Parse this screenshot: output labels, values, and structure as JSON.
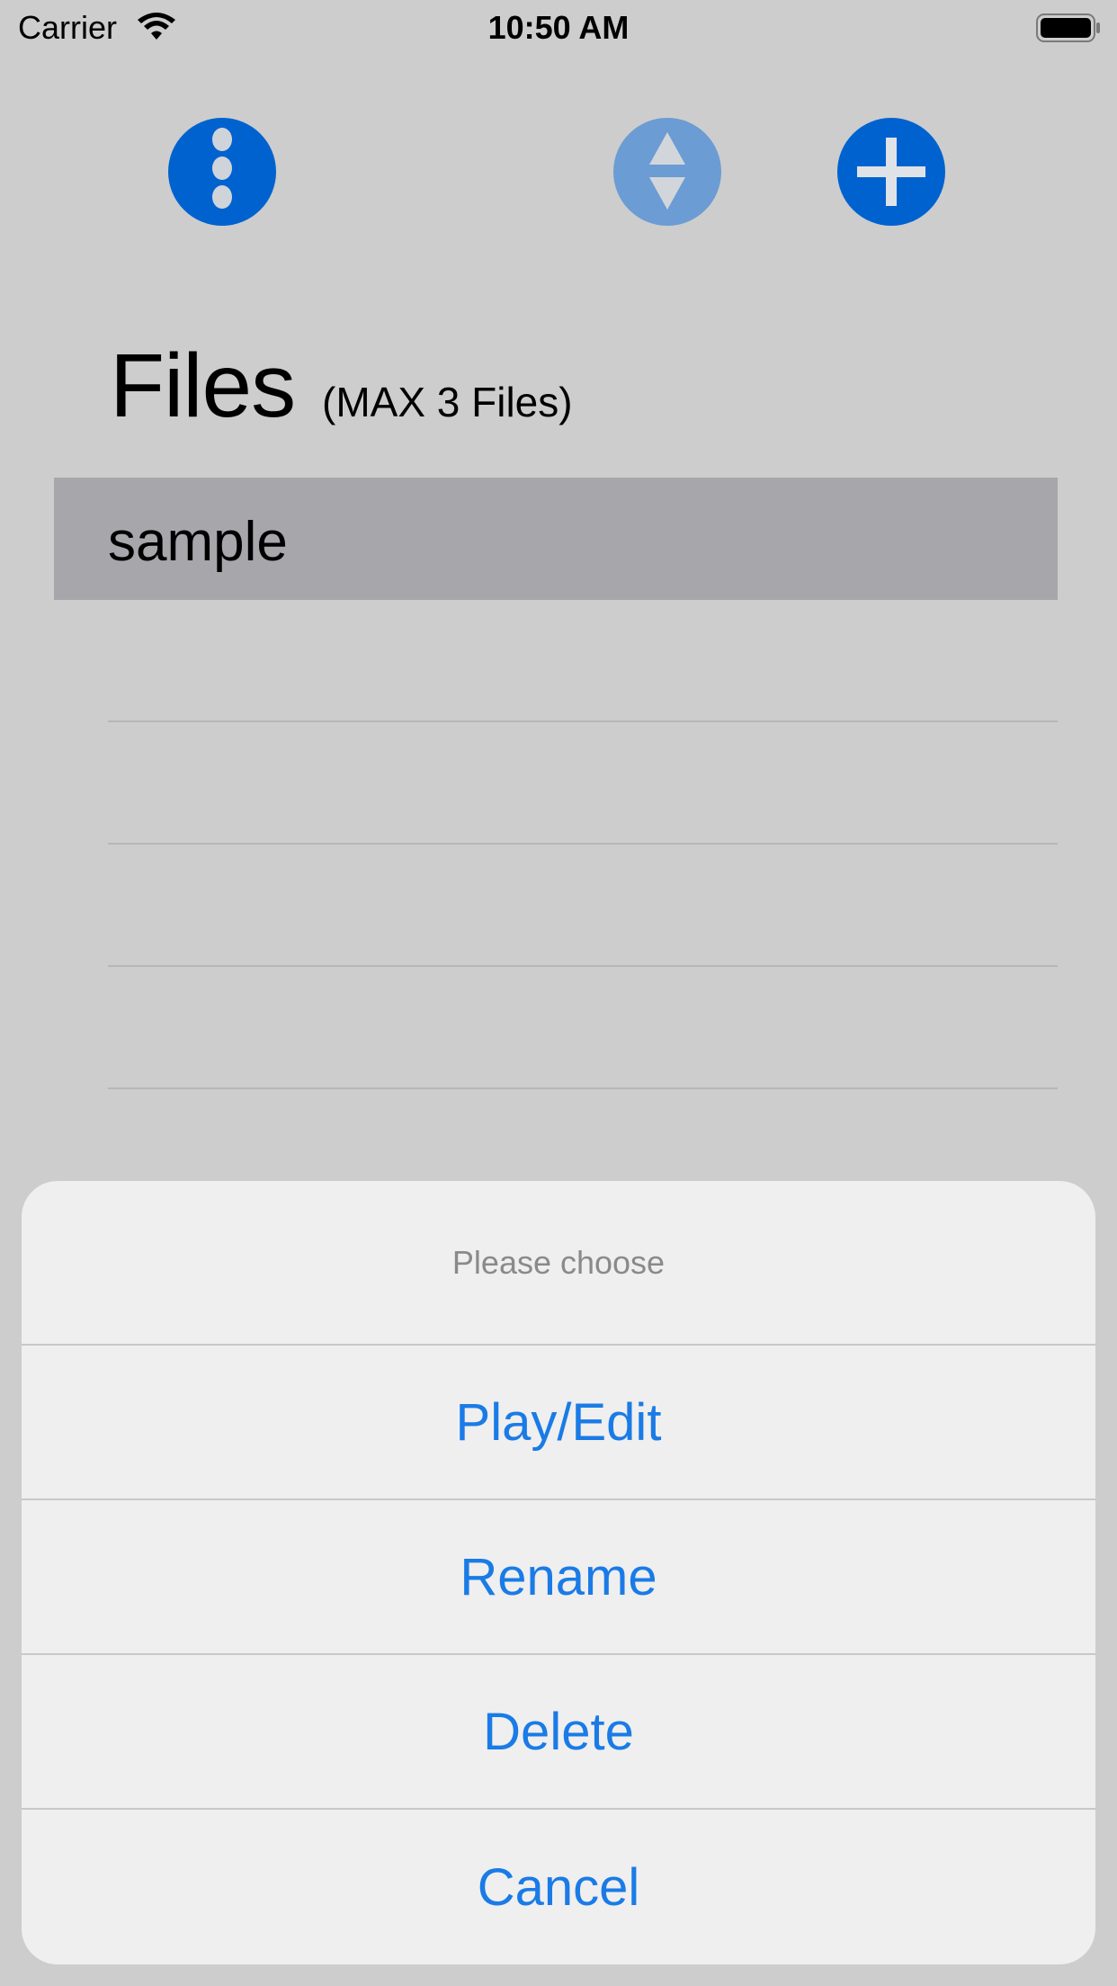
{
  "status_bar": {
    "carrier": "Carrier",
    "time": "10:50 AM"
  },
  "toolbar": {
    "more_icon": "more-vertical-icon",
    "sort_icon": "sort-icon",
    "add_icon": "plus-icon",
    "accent_color": "#0062cf",
    "disabled_color": "#6b9cd4"
  },
  "header": {
    "title": "Files",
    "subtitle": "(MAX 3 Files)"
  },
  "files": {
    "rows": [
      {
        "label": "sample",
        "selected": true
      },
      {
        "label": "",
        "selected": false
      },
      {
        "label": "",
        "selected": false
      },
      {
        "label": "",
        "selected": false
      },
      {
        "label": "",
        "selected": false
      }
    ]
  },
  "action_sheet": {
    "title": "Please choose",
    "actions": [
      "Play/Edit",
      "Rename",
      "Delete",
      "Cancel"
    ],
    "action_color": "#1a7be6"
  }
}
